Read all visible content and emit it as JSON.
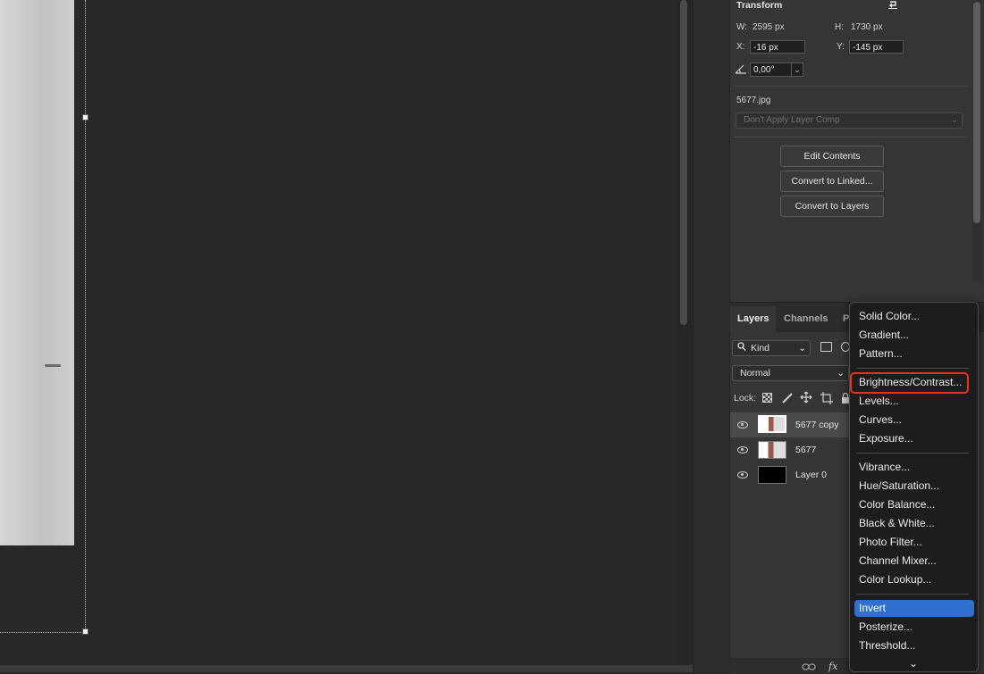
{
  "properties": {
    "section_title": "Transform",
    "w_label": "W:",
    "w_value": "2595 px",
    "h_label": "H:",
    "h_value": "1730 px",
    "x_label": "X:",
    "x_value": "-16 px",
    "y_label": "Y:",
    "y_value": "-145 px",
    "angle_value": "0,00°",
    "filename": "5677.jpg",
    "layer_comp_placeholder": "Don't Apply Layer Comp",
    "buttons": [
      "Edit Contents",
      "Convert to Linked...",
      "Convert to Layers"
    ]
  },
  "layers_panel": {
    "tabs": [
      "Layers",
      "Channels",
      "Pa"
    ],
    "filter_kind": "Kind",
    "blend_mode": "Normal",
    "lock_label": "Lock:",
    "layers": [
      {
        "name": "5677 copy",
        "selected": true
      },
      {
        "name": "5677",
        "selected": false
      },
      {
        "name": "Layer 0",
        "selected": false
      }
    ],
    "footer_fx": "fx"
  },
  "adjustment_menu": {
    "group1": [
      "Solid Color...",
      "Gradient...",
      "Pattern..."
    ],
    "group2": [
      "Brightness/Contrast...",
      "Levels...",
      "Curves...",
      "Exposure..."
    ],
    "group3": [
      "Vibrance...",
      "Hue/Saturation...",
      "Color Balance...",
      "Black & White...",
      "Photo Filter...",
      "Channel Mixer...",
      "Color Lookup..."
    ],
    "group4": [
      "Invert",
      "Posterize...",
      "Threshold..."
    ],
    "highlighted_item": "Invert",
    "outlined_item": "Brightness/Contrast..."
  },
  "colors": {
    "highlight": "#2f6fd2",
    "outline": "#e8321b"
  }
}
